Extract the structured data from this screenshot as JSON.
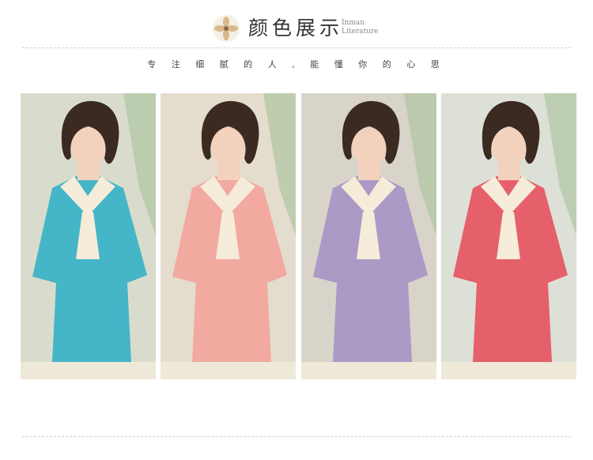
{
  "header": {
    "title": "颜色展示",
    "brand_line1": "Inman",
    "brand_line2": "Literature",
    "icon": "flower-icon"
  },
  "subtitle": "专 注 细 腻 的 人 , 能 懂 你 的 心 思",
  "products": [
    {
      "color_name": "blue",
      "shirt_color": "#45b5c8",
      "bg": "#d9dccc"
    },
    {
      "color_name": "pink",
      "shirt_color": "#f2a9a0",
      "bg": "#e4dccd"
    },
    {
      "color_name": "purple",
      "shirt_color": "#ab9ac6",
      "bg": "#d8d4c9"
    },
    {
      "color_name": "red",
      "shirt_color": "#e5606a",
      "bg": "#dde0d6"
    }
  ],
  "colors": {
    "collar": "#f5ecd9",
    "pants": "#efe9da",
    "skin": "#f3d2bd",
    "hair": "#3b2a22",
    "dash": "#d9d2c4"
  }
}
